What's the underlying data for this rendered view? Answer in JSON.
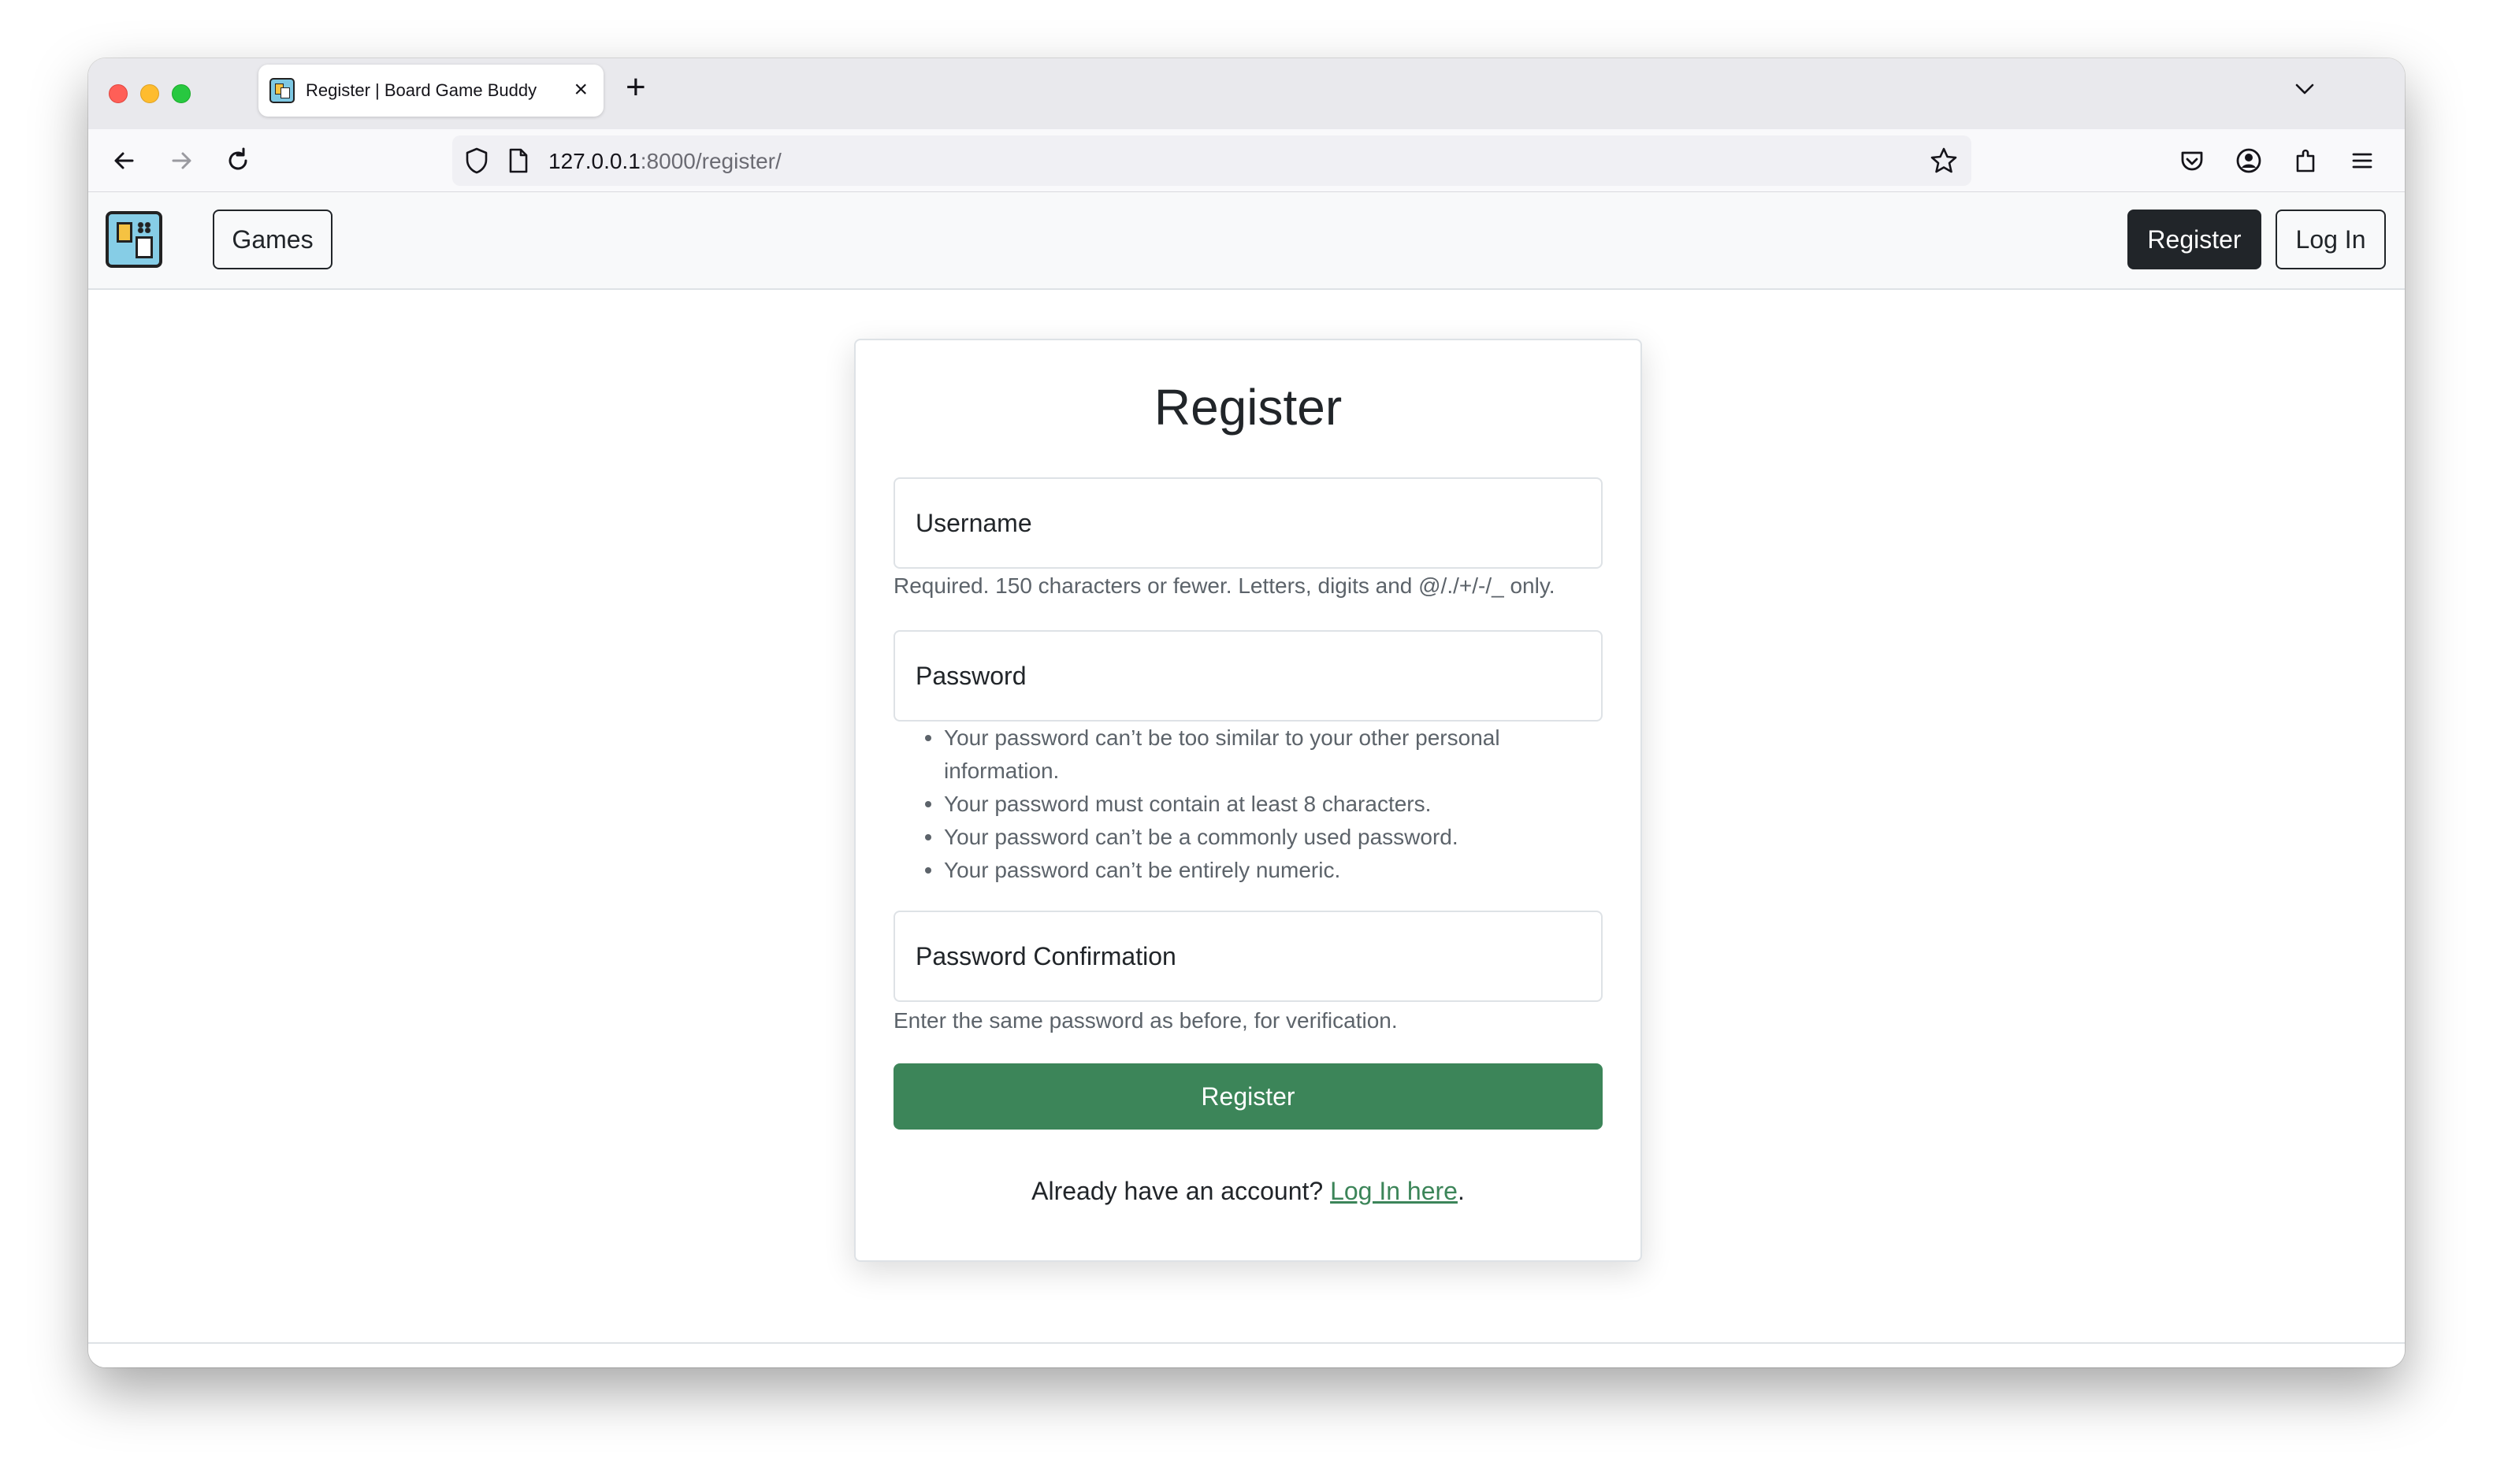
{
  "browser": {
    "tab": {
      "title": "Register | Board Game Buddy",
      "close_icon": "×"
    },
    "new_tab_icon": "+",
    "url": {
      "host": "127.0.0.1",
      "rest": ":8000/register/"
    }
  },
  "navbar": {
    "logo_icon": "board-game-logo",
    "games_label": "Games",
    "register_label": "Register",
    "login_label": "Log In"
  },
  "form": {
    "title": "Register",
    "username": {
      "label": "Username",
      "help": "Required. 150 characters or fewer. Letters, digits and @/./+/-/_ only."
    },
    "password": {
      "label": "Password",
      "help_items": [
        "Your password can’t be too similar to your other personal information.",
        "Your password must contain at least 8 characters.",
        "Your password can’t be a commonly used password.",
        "Your password can’t be entirely numeric."
      ]
    },
    "password_confirmation": {
      "label": "Password Confirmation",
      "help": "Enter the same password as before, for verification."
    },
    "submit_label": "Register",
    "footer": {
      "prefix": "Already have an account? ",
      "link": "Log In here",
      "suffix": "."
    }
  },
  "colors": {
    "accent_green": "#3c8559",
    "dark": "#212529"
  }
}
